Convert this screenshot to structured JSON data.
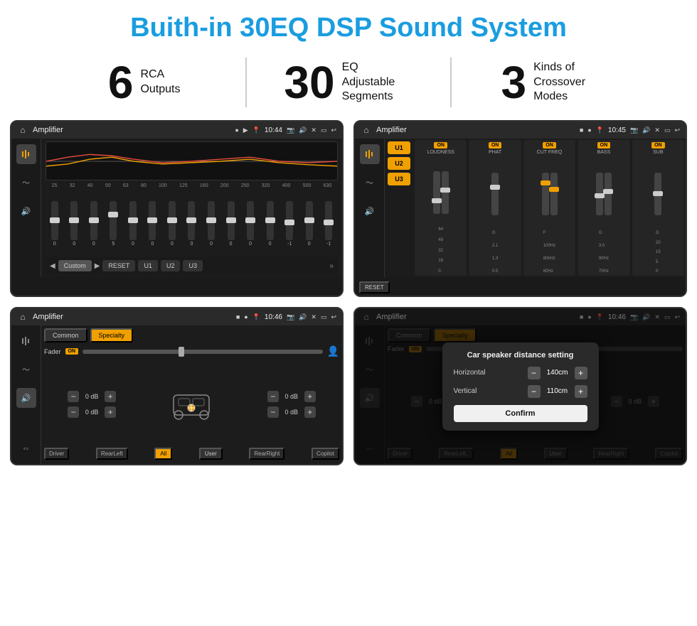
{
  "page": {
    "title": "Buith-in 30EQ DSP Sound System"
  },
  "stats": [
    {
      "number": "6",
      "label": "RCA\nOutputs"
    },
    {
      "number": "30",
      "label": "EQ Adjustable\nSegments"
    },
    {
      "number": "3",
      "label": "Kinds of\nCrossover Modes"
    }
  ],
  "screen1": {
    "app": "Amplifier",
    "time": "10:44",
    "eq_labels": [
      "25",
      "32",
      "40",
      "50",
      "63",
      "80",
      "100",
      "125",
      "160",
      "200",
      "250",
      "320",
      "400",
      "500",
      "630"
    ],
    "eq_values": [
      "0",
      "0",
      "0",
      "5",
      "0",
      "0",
      "0",
      "0",
      "0",
      "0",
      "0",
      "0",
      "-1",
      "0",
      "-1"
    ],
    "preset": "Custom",
    "buttons": [
      "RESET",
      "U1",
      "U2",
      "U3"
    ]
  },
  "screen2": {
    "app": "Amplifier",
    "time": "10:45",
    "u_buttons": [
      "U1",
      "U2",
      "U3"
    ],
    "controls": [
      {
        "label": "LOUDNESS",
        "on": true
      },
      {
        "label": "PHAT",
        "on": true
      },
      {
        "label": "CUT FREQ",
        "on": true
      },
      {
        "label": "BASS",
        "on": true
      },
      {
        "label": "SUB",
        "on": true
      }
    ],
    "reset_label": "RESET"
  },
  "screen3": {
    "app": "Amplifier",
    "time": "10:46",
    "tabs": [
      "Common",
      "Specialty"
    ],
    "fader_label": "Fader",
    "fader_on": "ON",
    "db_controls": [
      {
        "value": "0 dB"
      },
      {
        "value": "0 dB"
      },
      {
        "value": "0 dB"
      },
      {
        "value": "0 dB"
      }
    ],
    "bottom_labels": [
      "Driver",
      "RearLeft",
      "All",
      "User",
      "RearRight",
      "Copilot"
    ]
  },
  "screen4": {
    "app": "Amplifier",
    "time": "10:46",
    "tabs": [
      "Common",
      "Specialty"
    ],
    "dialog": {
      "title": "Car speaker distance setting",
      "horizontal_label": "Horizontal",
      "horizontal_value": "140cm",
      "vertical_label": "Vertical",
      "vertical_value": "110cm",
      "confirm_label": "Confirm"
    },
    "bottom_labels": [
      "Driver",
      "RearLeft..",
      "All",
      "User",
      "RearRight",
      "Copilot"
    ],
    "db_right": [
      "0 dB",
      "0 dB"
    ]
  }
}
